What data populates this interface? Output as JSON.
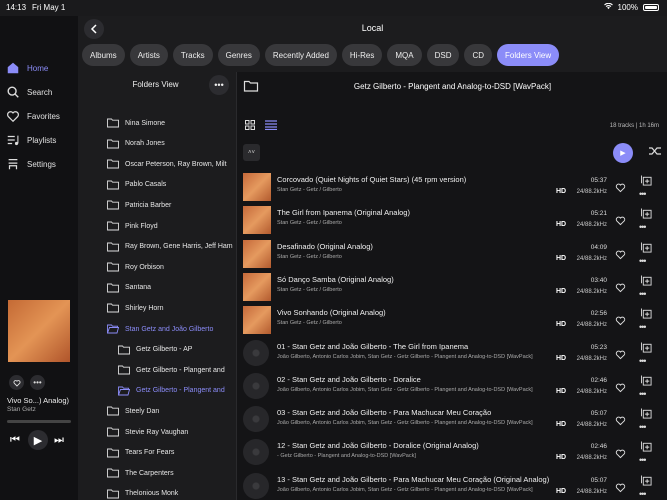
{
  "status": {
    "time": "14:13",
    "date": "Fri May 1",
    "battery": "100%"
  },
  "sidebar": {
    "items": [
      {
        "label": "Home",
        "icon": "home-icon",
        "active": true
      },
      {
        "label": "Search",
        "icon": "search-icon",
        "active": false
      },
      {
        "label": "Favorites",
        "icon": "heart-icon",
        "active": false
      },
      {
        "label": "Playlists",
        "icon": "playlist-icon",
        "active": false
      },
      {
        "label": "Settings",
        "icon": "settings-icon",
        "active": false
      }
    ],
    "now_playing": {
      "title": "Vivo So...) Analog)",
      "artist": "Stan Getz"
    }
  },
  "header": {
    "title": "Local"
  },
  "tabs": [
    {
      "label": "Albums"
    },
    {
      "label": "Artists"
    },
    {
      "label": "Tracks"
    },
    {
      "label": "Genres"
    },
    {
      "label": "Recently Added"
    },
    {
      "label": "Hi-Res"
    },
    {
      "label": "MQA"
    },
    {
      "label": "DSD"
    },
    {
      "label": "CD"
    },
    {
      "label": "Folders View",
      "active": true
    }
  ],
  "folders": {
    "title": "Folders View",
    "items": [
      {
        "label": "Nina Simone"
      },
      {
        "label": "Norah Jones"
      },
      {
        "label": "Oscar Peterson, Ray Brown, Milt"
      },
      {
        "label": "Pablo Casals"
      },
      {
        "label": "Patricia Barber"
      },
      {
        "label": "Pink Floyd"
      },
      {
        "label": "Ray Brown, Gene Harris, Jeff Ham"
      },
      {
        "label": "Roy Orbison"
      },
      {
        "label": "Santana"
      },
      {
        "label": "Shirley Horn"
      },
      {
        "label": "Stan Getz and João Gilberto",
        "active": true,
        "open": true
      },
      {
        "label": "Getz Gilberto - AP",
        "indent": 1
      },
      {
        "label": "Getz Gilberto - Plangent and",
        "indent": 1
      },
      {
        "label": "Getz Gilberto - Plangent and",
        "indent": 1,
        "active": true,
        "open": true
      },
      {
        "label": "Steely Dan"
      },
      {
        "label": "Stevie Ray Vaughan"
      },
      {
        "label": "Tears For Fears"
      },
      {
        "label": "The Carpenters"
      },
      {
        "label": "Thelonious Monk"
      }
    ]
  },
  "panel": {
    "title": "Getz Gilberto - Plangent and Analog-to-DSD [WavPack]",
    "track_count": "18 tracks",
    "duration": "1h 16m",
    "sort_label": "˄˅",
    "tracks": [
      {
        "title": "Corcovado (Quiet Nights of Quiet Stars) (45 rpm version)",
        "sub": "Stan Getz - Getz / Gilberto",
        "duration": "05:37",
        "format": "24/88.2kHz",
        "cover": true
      },
      {
        "title": "The Girl from Ipanema (Original Analog)",
        "sub": "Stan Getz - Getz / Gilberto",
        "duration": "05:21",
        "format": "24/88.2kHz",
        "cover": true
      },
      {
        "title": "Desafinado (Original Analog)",
        "sub": "Stan Getz - Getz / Gilberto",
        "duration": "04:09",
        "format": "24/88.2kHz",
        "cover": true
      },
      {
        "title": "Só Danço Samba (Original Analog)",
        "sub": "Stan Getz - Getz / Gilberto",
        "duration": "03:40",
        "format": "24/88.2kHz",
        "cover": true
      },
      {
        "title": "Vivo Sonhando (Original Analog)",
        "sub": "Stan Getz - Getz / Gilberto",
        "duration": "02:56",
        "format": "24/88.2kHz",
        "cover": true
      },
      {
        "title": "01 - Stan Getz and João Gilberto - The Girl from Ipanema",
        "sub": "João Gilberto, Antonio Carlos Jobim, Stan Getz - Getz Gilberto - Plangent and Analog-to-DSD [WavPack]",
        "duration": "05:23",
        "format": "24/88.2kHz",
        "cover": false
      },
      {
        "title": "02 - Stan Getz and João Gilberto - Doralice",
        "sub": "João Gilberto, Antonio Carlos Jobim, Stan Getz - Getz Gilberto - Plangent and Analog-to-DSD [WavPack]",
        "duration": "02:46",
        "format": "24/88.2kHz",
        "cover": false
      },
      {
        "title": "03 - Stan Getz and João Gilberto - Para Machucar Meu Coração",
        "sub": "João Gilberto, Antonio Carlos Jobim, Stan Getz - Getz Gilberto - Plangent and Analog-to-DSD [WavPack]",
        "duration": "05:07",
        "format": "24/88.2kHz",
        "cover": false
      },
      {
        "title": "12 - Stan Getz and João Gilberto - Doralice (Original Analog)",
        "sub": "- Getz Gilberto - Plangent and Analog-to-DSD [WavPack]",
        "duration": "02:46",
        "format": "24/88.2kHz",
        "cover": false
      },
      {
        "title": "13 - Stan Getz and João Gilberto - Para Machucar Meu Coração (Original Analog)",
        "sub": "João Gilberto, Antonio Carlos Jobim, Stan Getz - Getz Gilberto - Plangent and Analog-to-DSD [WavPack]",
        "duration": "05:07",
        "format": "24/88.2kHz",
        "cover": false
      }
    ],
    "hd_label": "HD"
  },
  "colors": {
    "accent": "#8b8cf8",
    "background": "#1c1c1e",
    "sidebar": "#111113"
  }
}
